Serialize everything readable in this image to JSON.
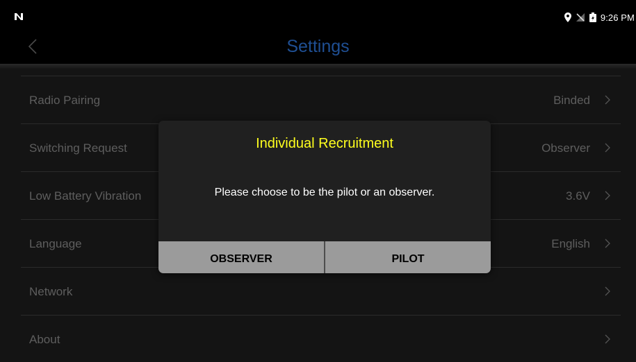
{
  "status_bar": {
    "time": "9:26 PM",
    "icons": [
      "n-notification-icon",
      "location-pin-icon",
      "no-signal-icon",
      "battery-icon"
    ]
  },
  "header": {
    "title": "Settings",
    "back_icon": "chevron-left-icon"
  },
  "settings": {
    "items": [
      {
        "label": "Radio Pairing",
        "value": "Binded"
      },
      {
        "label": "Switching Request",
        "value": "Observer"
      },
      {
        "label": "Low Battery Vibration",
        "value": "3.6V"
      },
      {
        "label": "Language",
        "value": "English"
      },
      {
        "label": "Network",
        "value": ""
      },
      {
        "label": "About",
        "value": ""
      }
    ],
    "chevron_icon": "chevron-right-icon"
  },
  "dialog": {
    "title": "Individual Recruitment",
    "message": "Please choose to be the pilot or an observer.",
    "buttons": {
      "observer": "OBSERVER",
      "pilot": "PILOT"
    }
  },
  "colors": {
    "title": "#1f4f93",
    "dialog_title": "#ffff1e",
    "dialog_bg": "#202020",
    "button_bar": "#9b9b9b"
  }
}
